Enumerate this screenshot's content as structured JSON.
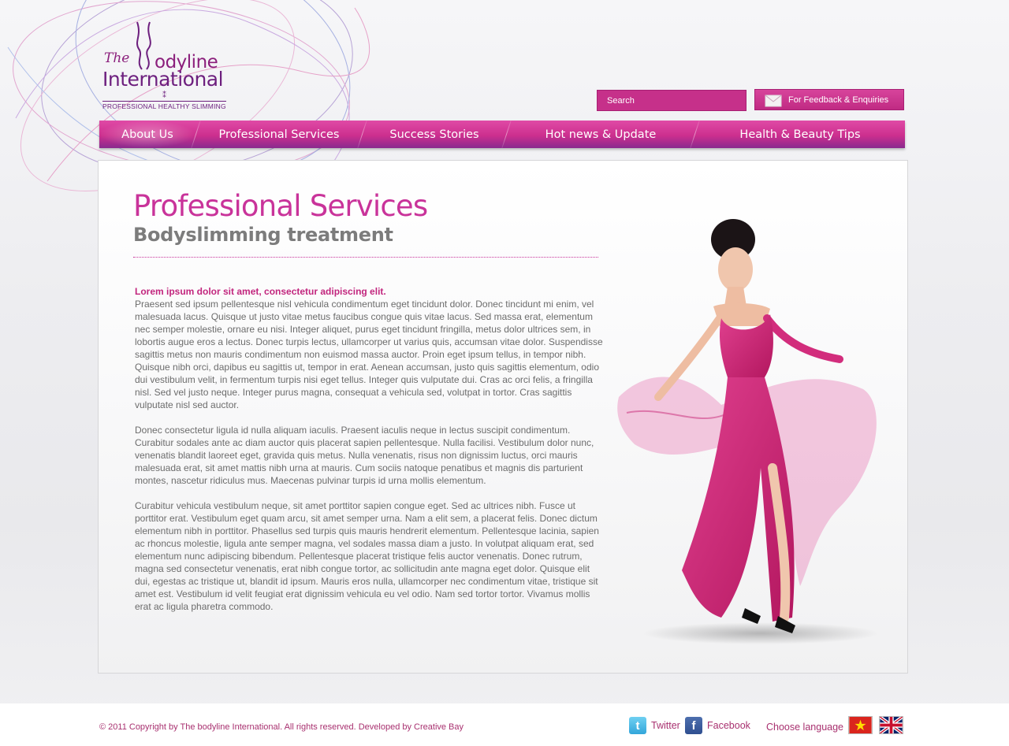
{
  "brand": {
    "logo_the": "The",
    "logo_rest": "odyline",
    "logo_international": "International",
    "logo_mark": "⁑",
    "logo_tagline": "PROFESSIONAL HEALTHY SLIMMING",
    "primary_color": "#c9339a",
    "accent_color": "#8a2a8e"
  },
  "header": {
    "search_placeholder": "Search",
    "feedback_label": "For Feedback & Enquiries"
  },
  "nav": {
    "items": [
      {
        "label": "About Us",
        "active": true
      },
      {
        "label": "Professional Services",
        "active": false
      },
      {
        "label": "Success Stories",
        "active": false
      },
      {
        "label": "Hot news & Update",
        "active": false
      },
      {
        "label": "Health & Beauty Tips",
        "active": false
      }
    ]
  },
  "main": {
    "title": "Professional Services",
    "subtitle": "Bodyslimming treatment",
    "lead": "Lorem ipsum dolor sit amet, consectetur adipiscing elit.",
    "paragraph1": "Praesent sed ipsum pellentesque nisl vehicula condimentum eget tincidunt dolor. Donec tincidunt mi enim, vel malesuada lacus. Quisque ut justo vitae metus faucibus congue quis vitae lacus. Sed massa erat, elementum nec semper molestie, ornare eu nisi. Integer aliquet, purus eget tincidunt fringilla, metus dolor ultrices sem, in lobortis augue eros a lectus. Donec turpis lectus, ullamcorper ut varius quis, accumsan vitae dolor. Suspendisse sagittis metus non mauris condimentum non euismod massa auctor. Proin eget ipsum tellus, in tempor nibh. Quisque nibh orci, dapibus eu sagittis ut, tempor in erat. Aenean accumsan, justo quis sagittis elementum, odio dui vestibulum velit, in fermentum turpis nisi eget tellus. Integer quis vulputate dui. Cras ac orci felis, a fringilla nisl. Sed vel justo neque. Integer purus magna, consequat a vehicula sed, volutpat in tortor. Cras sagittis vulputate nisl sed auctor.",
    "paragraph2": "Donec consectetur ligula id nulla aliquam iaculis. Praesent iaculis neque in lectus suscipit condimentum. Curabitur sodales ante ac diam auctor quis placerat sapien pellentesque. Nulla facilisi. Vestibulum dolor nunc, venenatis blandit laoreet eget, gravida quis metus. Nulla venenatis, risus non dignissim luctus, orci mauris malesuada erat, sit amet mattis nibh urna at mauris. Cum sociis natoque penatibus et magnis dis parturient montes, nascetur ridiculus mus. Maecenas pulvinar turpis id urna mollis elementum.",
    "paragraph3": "Curabitur vehicula vestibulum neque, sit amet porttitor sapien congue eget. Sed ac ultrices nibh. Fusce ut porttitor erat. Vestibulum eget quam arcu, sit amet semper urna. Nam a elit sem, a placerat felis. Donec dictum elementum nibh in porttitor. Phasellus sed turpis quis mauris hendrerit elementum. Pellentesque lacinia, sapien ac rhoncus molestie, ligula ante semper magna, vel sodales massa diam a justo. In volutpat aliquam erat, sed elementum nunc adipiscing bibendum. Pellentesque placerat tristique felis auctor venenatis. Donec rutrum, magna sed consectetur venenatis, erat nibh congue tortor, ac sollicitudin ante magna eget dolor. Quisque elit dui, egestas ac tristique ut, blandit id ipsum. Mauris eros nulla, ullamcorper nec condimentum vitae, tristique sit amet est. Vestibulum id velit feugiat erat dignissim vehicula eu vel odio. Nam sed tortor tortor. Vivamus mollis erat ac ligula pharetra commodo."
  },
  "footer": {
    "copyright": "© 2011 Copyright by The bodyline International. All rights reserved. Developed by Creative Bay",
    "twitter_label": "Twitter",
    "facebook_label": "Facebook",
    "language_label": "Choose language",
    "twitter_icon": "t",
    "facebook_icon": "f",
    "flags": [
      "vietnam-flag-icon",
      "uk-flag-icon"
    ]
  }
}
